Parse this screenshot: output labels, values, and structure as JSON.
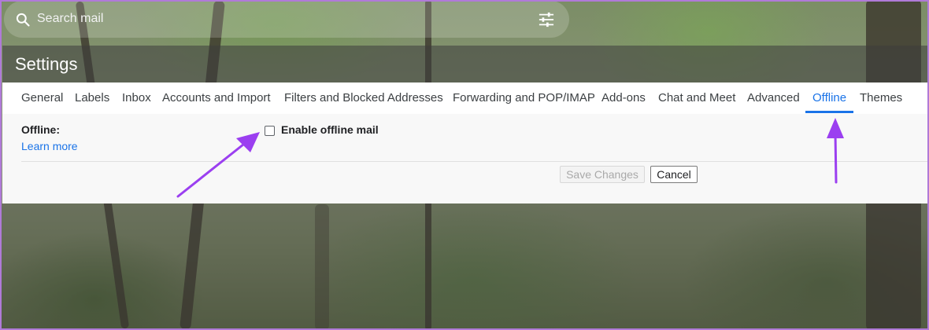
{
  "search": {
    "placeholder": "Search mail"
  },
  "header": {
    "title": "Settings"
  },
  "tabs": [
    {
      "label": "General"
    },
    {
      "label": "Labels"
    },
    {
      "label": "Inbox"
    },
    {
      "label": "Accounts and Import"
    },
    {
      "label": "Filters and Blocked Addresses"
    },
    {
      "label": "Forwarding and POP/IMAP"
    },
    {
      "label": "Add-ons"
    },
    {
      "label": "Chat and Meet"
    },
    {
      "label": "Advanced"
    },
    {
      "label": "Offline"
    },
    {
      "label": "Themes"
    }
  ],
  "active_tab": "Offline",
  "offline": {
    "label": "Offline:",
    "learn_more": "Learn more",
    "enable_label": "Enable offline mail",
    "enabled": false
  },
  "actions": {
    "save_label": "Save Changes",
    "cancel_label": "Cancel"
  },
  "colors": {
    "accent": "#1a73e8",
    "annotation_arrow": "#9b3ff0"
  },
  "icons": {
    "search": "search-icon",
    "filter": "tune-icon"
  }
}
